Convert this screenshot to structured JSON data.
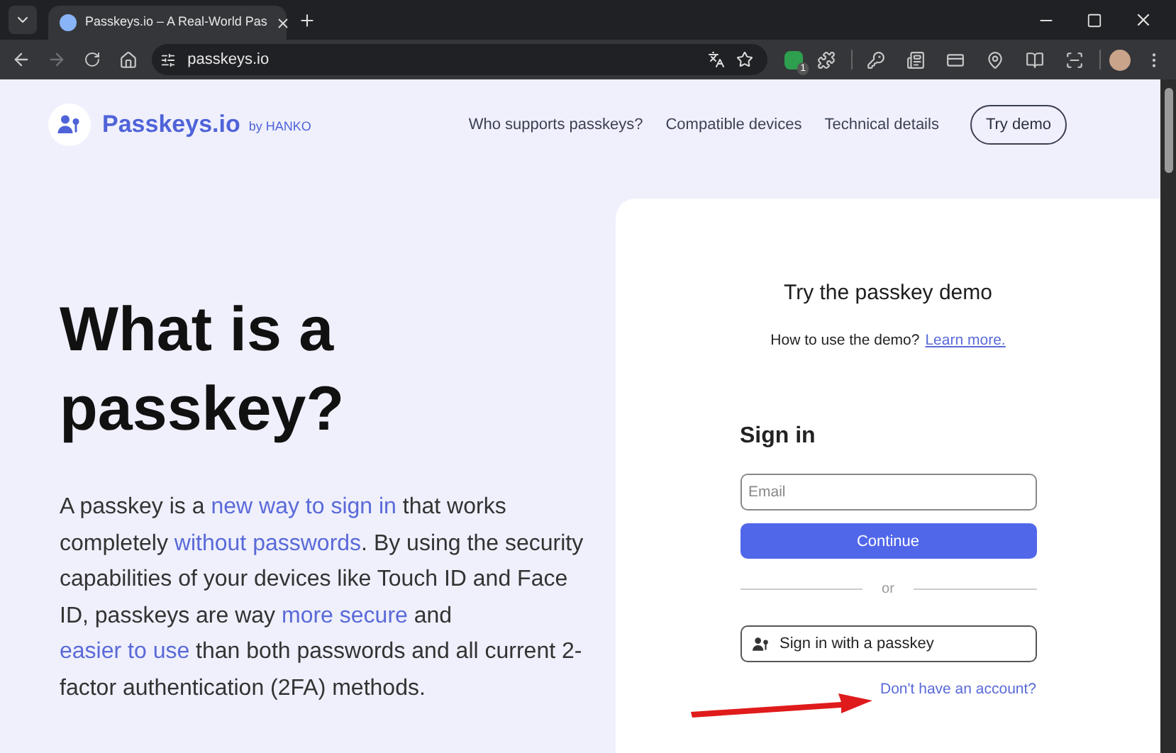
{
  "browser": {
    "tab_title": "Passkeys.io – A Real-World Pas",
    "url": "passkeys.io",
    "extension_badge": "1"
  },
  "header": {
    "logo": "Passkeys.io",
    "byline": "by HANKO",
    "nav": [
      "Who supports passkeys?",
      "Compatible devices",
      "Technical details"
    ],
    "cta": "Try demo"
  },
  "hero": {
    "heading": "What is a passkey?",
    "paragraph": [
      {
        "text": "A passkey is a ",
        "link": false
      },
      {
        "text": "new way to sign in",
        "link": true
      },
      {
        "text": " that works completely ",
        "link": false
      },
      {
        "text": "without passwords",
        "link": true
      },
      {
        "text": ". By using the security capabilities of your devices like Touch ID and Face ID, passkeys are way ",
        "link": false
      },
      {
        "text": "more secure",
        "link": true
      },
      {
        "text": " and ",
        "link": false
      },
      {
        "text": "easier to use",
        "link": true
      },
      {
        "text": " than both passwords and all current 2-factor authentication (2FA) methods.",
        "link": false
      }
    ]
  },
  "demo": {
    "title": "Try the passkey demo",
    "help": "How to use the demo?",
    "help_link": "Learn more.",
    "form_title": "Sign in",
    "email": {
      "placeholder": "Email"
    },
    "continue": "Continue",
    "divider": "or",
    "passkey_button": "Sign in with a passkey",
    "signup_link": "Don't have an account?"
  }
}
